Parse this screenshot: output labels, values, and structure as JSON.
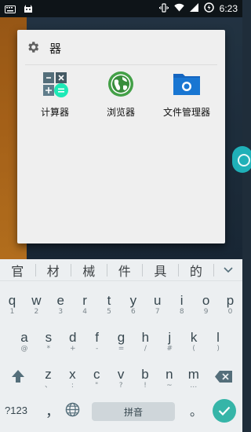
{
  "status_bar": {
    "time": "6:23"
  },
  "folder": {
    "title": "器",
    "apps": [
      {
        "label": "计算器"
      },
      {
        "label": "浏览器"
      },
      {
        "label": "文件管理器"
      }
    ]
  },
  "keyboard": {
    "suggestions": [
      "官",
      "材",
      "械",
      "件",
      "具",
      "的"
    ],
    "rows": [
      [
        {
          "main": "q",
          "sub": "1"
        },
        {
          "main": "w",
          "sub": "2"
        },
        {
          "main": "e",
          "sub": "3"
        },
        {
          "main": "r",
          "sub": "4"
        },
        {
          "main": "t",
          "sub": "5"
        },
        {
          "main": "y",
          "sub": "6"
        },
        {
          "main": "u",
          "sub": "7"
        },
        {
          "main": "i",
          "sub": "8"
        },
        {
          "main": "o",
          "sub": "9"
        },
        {
          "main": "p",
          "sub": "0"
        }
      ],
      [
        {
          "main": "a",
          "sub": "@"
        },
        {
          "main": "s",
          "sub": "*"
        },
        {
          "main": "d",
          "sub": "+"
        },
        {
          "main": "f",
          "sub": "-"
        },
        {
          "main": "g",
          "sub": "="
        },
        {
          "main": "h",
          "sub": "/"
        },
        {
          "main": "j",
          "sub": "#"
        },
        {
          "main": "k",
          "sub": "("
        },
        {
          "main": "l",
          "sub": ")"
        }
      ],
      [
        {
          "main": "z",
          "sub": "、"
        },
        {
          "main": "x",
          "sub": ":"
        },
        {
          "main": "c",
          "sub": "\""
        },
        {
          "main": "v",
          "sub": "?"
        },
        {
          "main": "b",
          "sub": "!"
        },
        {
          "main": "n",
          "sub": "~"
        },
        {
          "main": "m",
          "sub": "…"
        }
      ]
    ],
    "symbols_label": "?123",
    "comma": "，",
    "space_label": "拼音",
    "period": "。"
  },
  "colors": {
    "accent": "#36b5a8",
    "folder_bg": "#efefef",
    "keyboard_bg": "#eceff1"
  }
}
